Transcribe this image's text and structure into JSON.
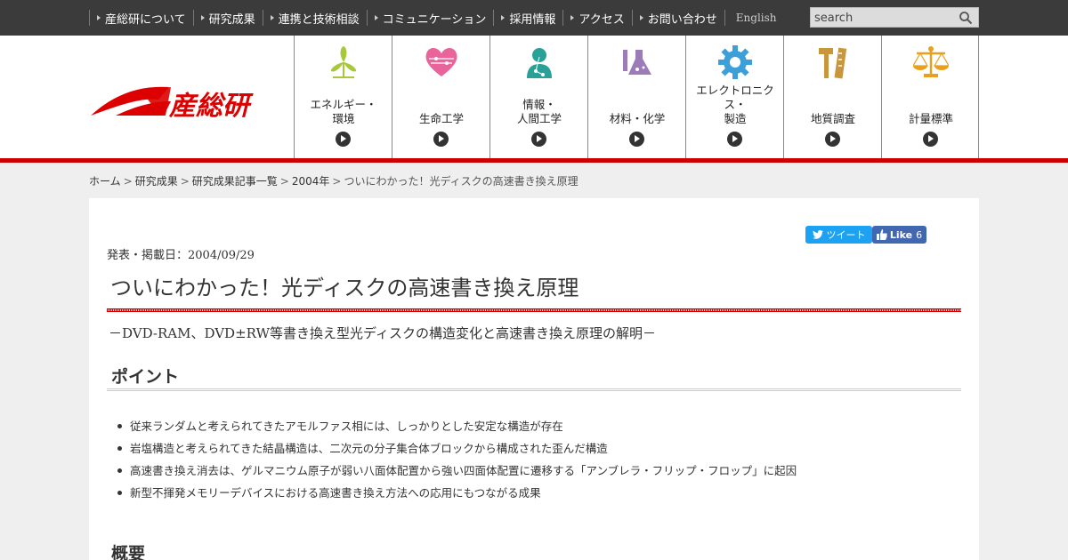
{
  "topnav": {
    "items": [
      "産総研について",
      "研究成果",
      "連携と技術相談",
      "コミュニケーション",
      "採用情報",
      "アクセス",
      "お問い合わせ"
    ],
    "english": "English"
  },
  "search": {
    "placeholder": "search"
  },
  "logo": {
    "text": "産総研"
  },
  "fields": [
    {
      "label": "エネルギー・\n環境",
      "icon": "wind-turbine-icon",
      "color": "#a8c83c"
    },
    {
      "label": "生命工学",
      "icon": "heart-icon",
      "color": "#e8649a"
    },
    {
      "label": "情報・\n人間工学",
      "icon": "person-network-icon",
      "color": "#2aa198"
    },
    {
      "label": "材料・化学",
      "icon": "flask-icon",
      "color": "#9b7bb8"
    },
    {
      "label": "エレクトロニクス・\n製造",
      "icon": "gear-icon",
      "color": "#3c9fd8"
    },
    {
      "label": "地質調査",
      "icon": "hammer-ruler-icon",
      "color": "#c8963c"
    },
    {
      "label": "計量標準",
      "icon": "balance-scale-icon",
      "color": "#e8a020"
    }
  ],
  "breadcrumb": {
    "items": [
      "ホーム",
      "研究成果",
      "研究成果記事一覧",
      "2004年"
    ],
    "current": "ついにわかった！光ディスクの高速書き換え原理"
  },
  "social": {
    "tweet": "ツイート",
    "like": "Like",
    "like_count": "6"
  },
  "article": {
    "pubdate": "発表・掲載日：2004/09/29",
    "title": "ついにわかった！光ディスクの高速書き換え原理",
    "subtitle": "－DVD-RAM、DVD±RW等書き換え型光ディスクの構造変化と高速書き換え原理の解明－",
    "point_heading": "ポイント",
    "points": [
      "従来ランダムと考えられてきたアモルファス相には、しっかりとした安定な構造が存在",
      "岩塩構造と考えられてきた結晶構造は、二次元の分子集合体ブロックから構成された歪んだ構造",
      "高速書き換え消去は、ゲルマニウム原子が弱い八面体配置から強い四面体配置に遷移する「アンブレラ・フリップ・フロップ」に起因",
      "新型不揮発メモリーデバイスにおける高速書き換え方法への応用にもつながる成果"
    ],
    "summary_heading": "概要"
  },
  "colors": {
    "brand_red": "#cc0000",
    "topbar": "#3b3b3b",
    "twitter": "#1da1f2",
    "facebook": "#4267b2"
  }
}
